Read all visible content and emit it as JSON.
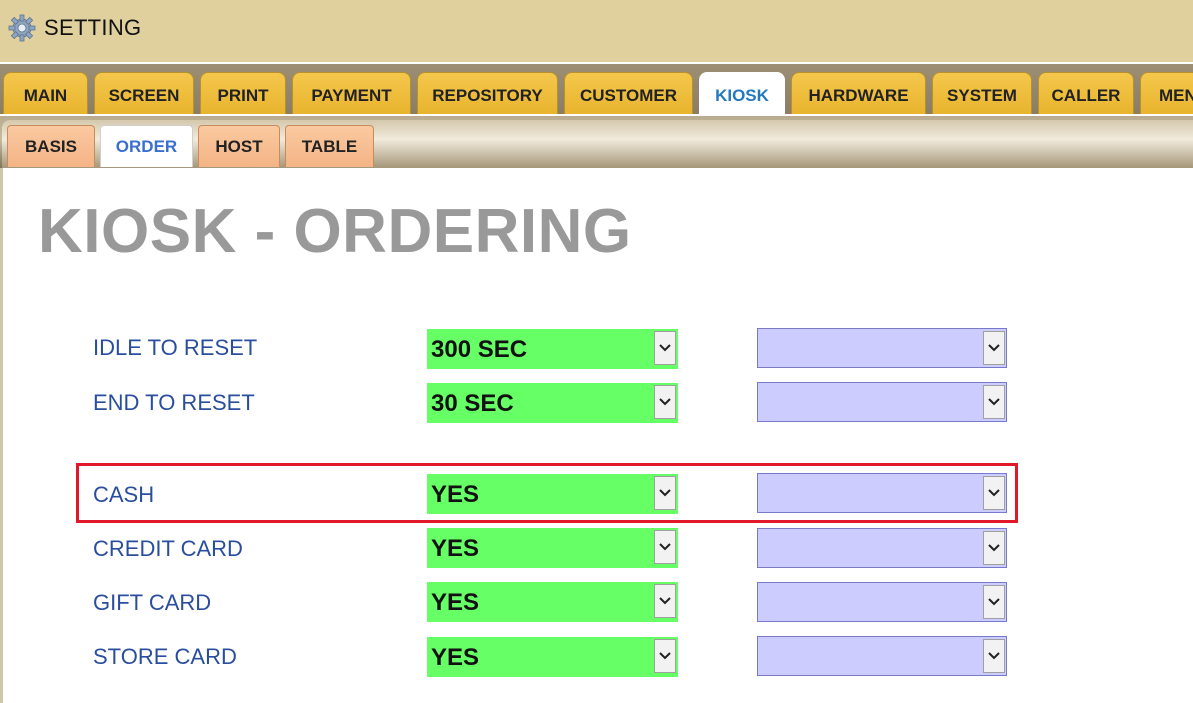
{
  "window": {
    "title": "SETTING",
    "icon": "gear-icon"
  },
  "main_tabs": [
    {
      "label": "MAIN"
    },
    {
      "label": "SCREEN"
    },
    {
      "label": "PRINT"
    },
    {
      "label": "PAYMENT"
    },
    {
      "label": "REPOSITORY"
    },
    {
      "label": "CUSTOMER"
    },
    {
      "label": "KIOSK",
      "active": true
    },
    {
      "label": "HARDWARE"
    },
    {
      "label": "SYSTEM"
    },
    {
      "label": "CALLER"
    },
    {
      "label": "MEN"
    }
  ],
  "sub_tabs": [
    {
      "label": "BASIS"
    },
    {
      "label": "ORDER",
      "active": true
    },
    {
      "label": "HOST"
    },
    {
      "label": "TABLE"
    }
  ],
  "page_title": "KIOSK - ORDERING",
  "settings": [
    {
      "label": "IDLE TO RESET",
      "value": "300 SEC",
      "secondary": ""
    },
    {
      "label": "END TO RESET",
      "value": "30 SEC",
      "secondary": ""
    },
    {
      "label": "CASH",
      "value": "YES",
      "secondary": "",
      "highlighted": true
    },
    {
      "label": "CREDIT CARD",
      "value": "YES",
      "secondary": ""
    },
    {
      "label": "GIFT CARD",
      "value": "YES",
      "secondary": ""
    },
    {
      "label": "STORE CARD",
      "value": "YES",
      "secondary": ""
    }
  ],
  "colors": {
    "title_bar": "#dfd09e",
    "main_tab": "#f4c74c",
    "sub_tab": "#fbc9a0",
    "active_main_tab_text": "#2379c0",
    "active_sub_tab_text": "#3a6fd0",
    "value_select": "#66ff66",
    "secondary_select": "#ccccff",
    "label_text": "#2a4e9e",
    "highlight_border": "#e0182a"
  }
}
